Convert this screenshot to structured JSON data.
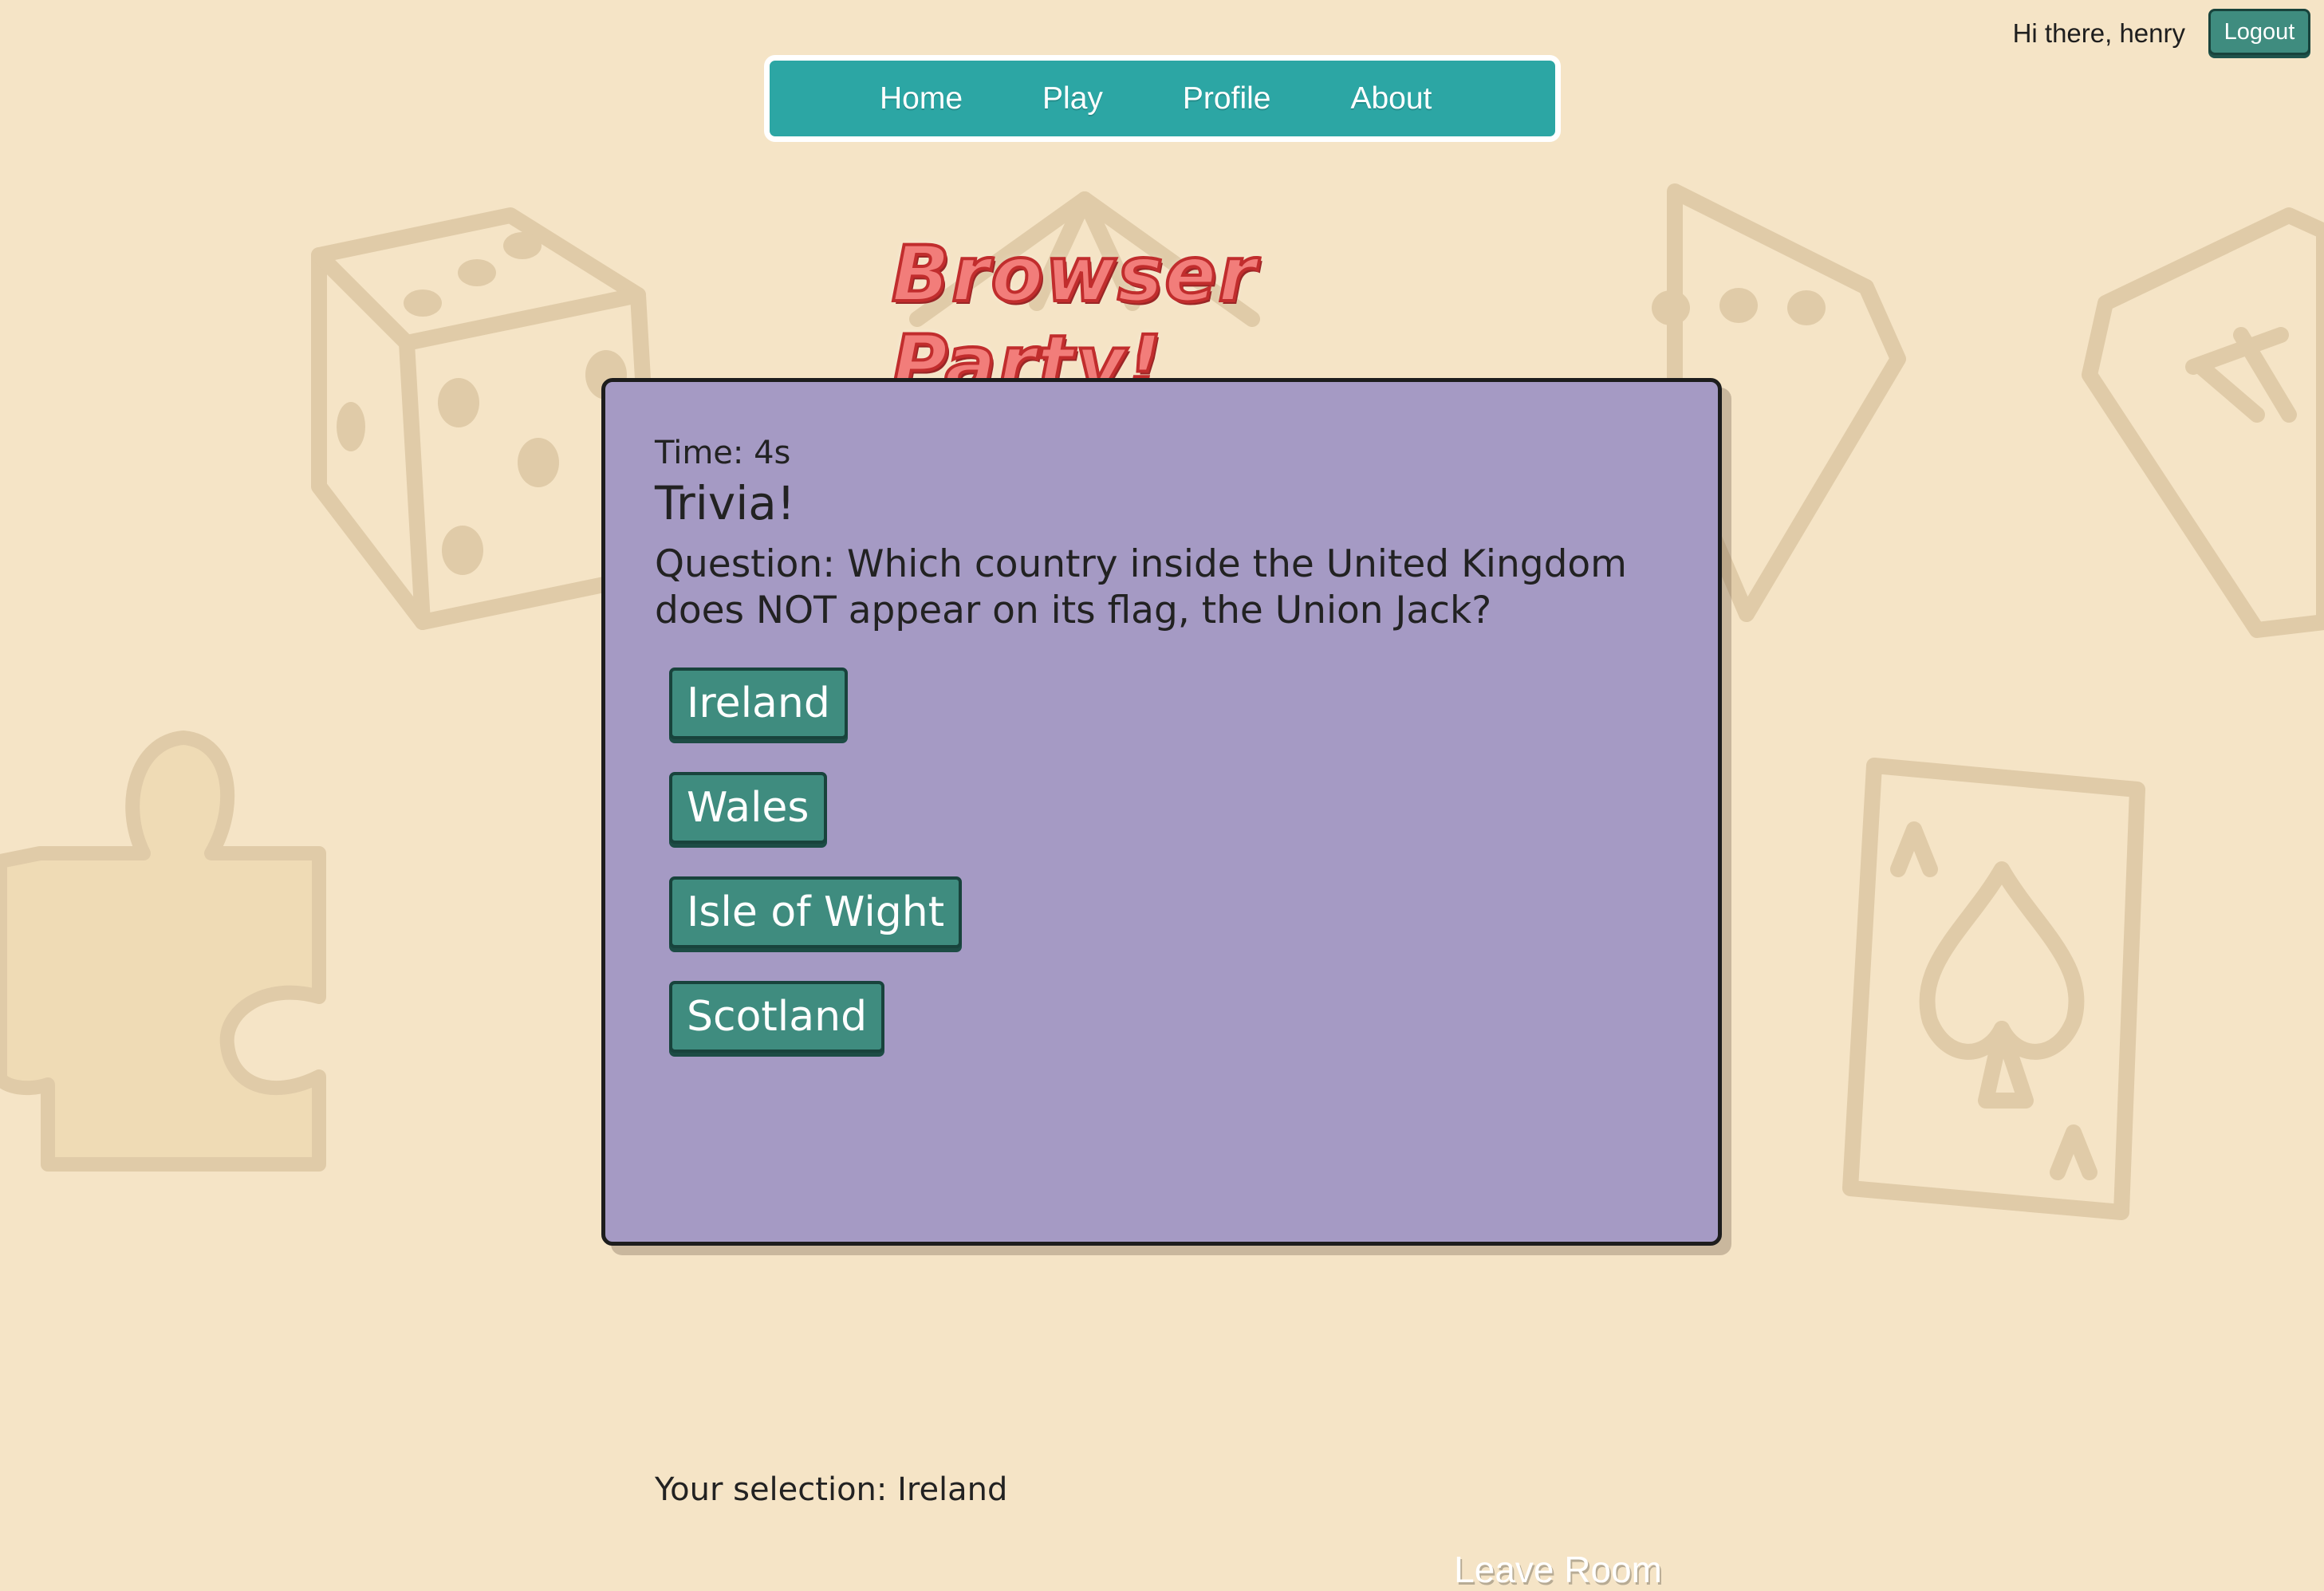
{
  "header": {
    "greeting": "Hi there, henry",
    "logout_label": "Logout"
  },
  "nav": {
    "items": [
      {
        "label": "Home"
      },
      {
        "label": "Play"
      },
      {
        "label": "Profile"
      },
      {
        "label": "About"
      }
    ]
  },
  "logo_text": "Browser Party!",
  "game": {
    "timer": "Time: 4s",
    "title": "Trivia!",
    "question": "Question: Which country inside the United Kingdom does NOT appear on its flag, the Union Jack?",
    "answers": [
      {
        "label": "Ireland"
      },
      {
        "label": "Wales"
      },
      {
        "label": "Isle of Wight"
      },
      {
        "label": "Scotland"
      }
    ],
    "selection": "Your selection: Ireland",
    "leave_label": "Leave Room"
  },
  "colors": {
    "background": "#f5e4c6",
    "navbar": "#2ca6a4",
    "panel": "#a59ac4",
    "button": "#3f8c7f",
    "logo": "#f27d7a"
  }
}
